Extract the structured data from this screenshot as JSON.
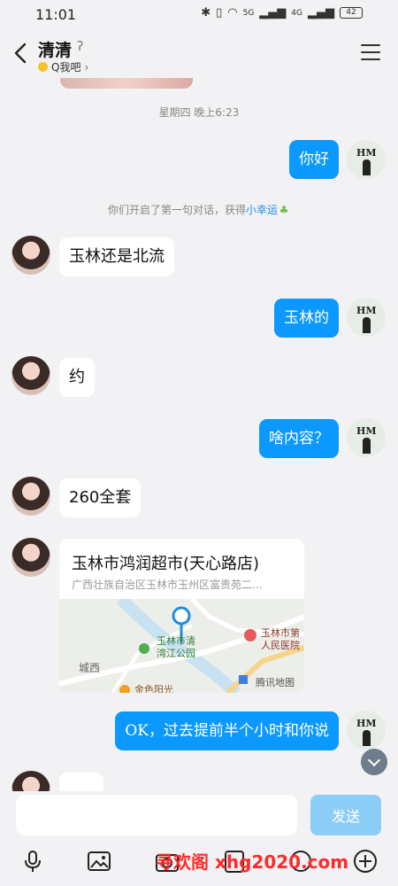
{
  "status_bar": {
    "time": "11:01",
    "battery": "42",
    "network_left": "5G",
    "network_right": "4G"
  },
  "header": {
    "title": "清清",
    "subtitle": "Q我吧"
  },
  "chat": {
    "timestamp": "星期四 晚上6:23",
    "system_message_prefix": "你们开启了第一句对话，获得",
    "system_message_link": "小幸运",
    "messages": [
      {
        "side": "out",
        "text": "你好"
      },
      {
        "side": "in",
        "text": "玉林还是北流"
      },
      {
        "side": "out",
        "text": "玉林的"
      },
      {
        "side": "in",
        "text": "约"
      },
      {
        "side": "out",
        "text": "啥内容？"
      },
      {
        "side": "in",
        "text": "260全套"
      },
      {
        "side": "out",
        "text": "OK，过去提前半个小时和你说"
      }
    ],
    "location": {
      "name": "玉林市鸿润超市(天心路店)",
      "address": "广西壮族自治区玉林市玉州区富贵苑二...",
      "map_labels": {
        "park": "玉林市清\n湾江公园",
        "hospital": "玉林市第\n人民医院",
        "district": "城西",
        "poi": "金色阳光",
        "provider": "腾讯地图"
      }
    },
    "my_avatar_logo": "HM"
  },
  "input_bar": {
    "placeholder": "",
    "send_label": "发送"
  },
  "watermark": "寻欢阁 xhg2020.com",
  "colors": {
    "outgoing_bubble": "#0b99ff",
    "send_button": "#8ccdf7",
    "link": "#1e8fe0"
  }
}
